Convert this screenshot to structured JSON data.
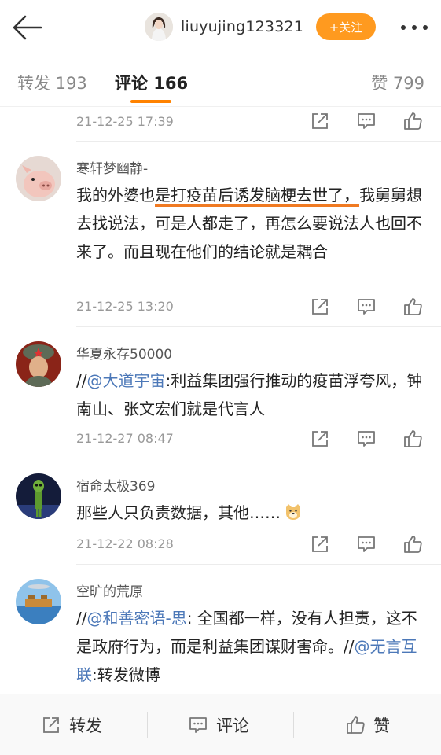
{
  "header": {
    "username": "liuyujing123321",
    "follow_label": "+关注"
  },
  "tabs": {
    "repost": "转发 193",
    "comment": "评论 166",
    "like": "赞 799"
  },
  "partial_comment": {
    "time": "21-12-25 17:39"
  },
  "comments": [
    {
      "name": "寒轩梦幽静-",
      "text_a": "我的外婆也",
      "text_hl": "是打疫苗后诱发脑梗去世了，",
      "text_b": "我舅舅想去找说法，可是人都走了，再怎么要说法人也回不来了。而且现在他们的结论就是耦合",
      "time": "21-12-25 13:20"
    },
    {
      "name": "华夏永存50000",
      "prefix": "//",
      "mention": "@大道宇宙",
      "text": ":利益集团强行推动的疫苗浮夸风，钟南山、张文宏们就是代言人",
      "time": "21-12-27 08:47"
    },
    {
      "name": "宿命太极369",
      "text": "那些人只负责数据，其他……",
      "time": "21-12-22 08:28"
    },
    {
      "name": "空旷的荒原",
      "prefix": "//",
      "mention": "@和善密语-思",
      "text": ": 全国都一样，没有人担责，这不是政府行为，而是利益集团谋财害命。//",
      "mention2": "@无言互联",
      "text2": ":转发微博"
    }
  ],
  "bottom": {
    "repost": "转发",
    "comment": "评论",
    "like": "赞"
  },
  "colors": {
    "accent": "#ff8200",
    "follow": "#ff9a1f",
    "mention": "#4c78b8",
    "highlight": "#f07a22"
  }
}
